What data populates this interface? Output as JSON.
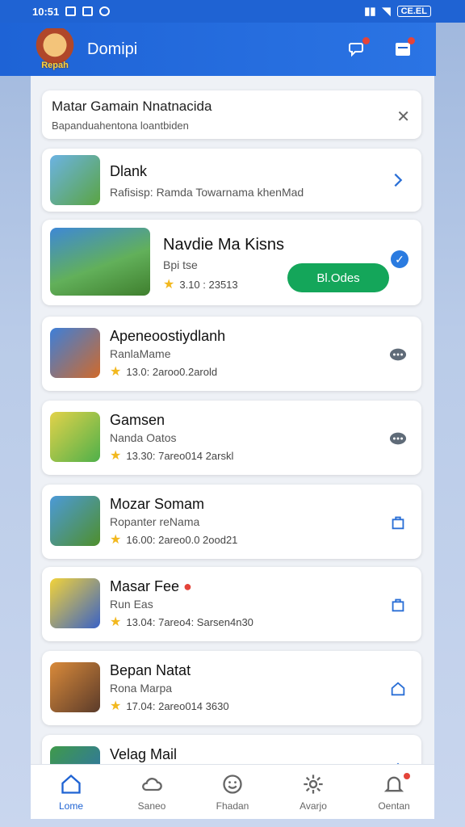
{
  "status": {
    "left_text": "10:51",
    "battery_text": "CE.EL"
  },
  "header": {
    "app_title": "Domipi",
    "logo_text": "Repah"
  },
  "notice": {
    "title": "Matar Gamain Nnatnacida",
    "subtitle": "Bapanduahentona loantbiden"
  },
  "list_item_1": {
    "title": "Dlank",
    "subtitle": "Rafisisp: Ramda Towarnama khenMad"
  },
  "featured": {
    "title": "Navdie Ma Kisns",
    "subtitle": "Bpi tse",
    "rating": "3.10 : 23513",
    "button_label": "Bl.Odes"
  },
  "games": [
    {
      "title": "Apeneoostiydlanh",
      "subtitle": "RanlaMame",
      "rating": "13.0: 2aroo0.2arold",
      "action": "chat-icon",
      "thumb": "FUNN"
    },
    {
      "title": "Gamsen",
      "subtitle": "Nanda Oatos",
      "rating": "13.30: 7areo014 2arskl",
      "action": "chat-icon",
      "thumb": ""
    },
    {
      "title": "Mozar Somam",
      "subtitle": "Ropanter reNama",
      "rating": "16.00: 2areo0.0 2ood21",
      "action": "bag-icon",
      "thumb": "FOREST"
    },
    {
      "title": "Masar Fee",
      "subtitle": "Run Eas",
      "rating": "13.04: 7areo4: Sarsen4n30",
      "action": "bag-icon",
      "thumb": "FUNN"
    },
    {
      "title": "Bepan Natat",
      "subtitle": "Rona Marpa",
      "rating": "17.04: 2areo014 3630",
      "action": "home-icon",
      "thumb": "SNAPAN"
    },
    {
      "title": "Velag Mail",
      "subtitle": "",
      "rating": "",
      "action": "chevron-up-icon",
      "thumb": ""
    }
  ],
  "nav": [
    {
      "label": "Lome",
      "icon": "home-icon"
    },
    {
      "label": "Saneo",
      "icon": "cloud-icon"
    },
    {
      "label": "Fhadan",
      "icon": "smile-icon"
    },
    {
      "label": "Avarjo",
      "icon": "gear-icon"
    },
    {
      "label": "Oentan",
      "icon": "bell-icon"
    }
  ],
  "colors": {
    "primary": "#1f63d3",
    "install": "#14a65a",
    "star": "#f2b81e",
    "badge": "#e4443a"
  }
}
